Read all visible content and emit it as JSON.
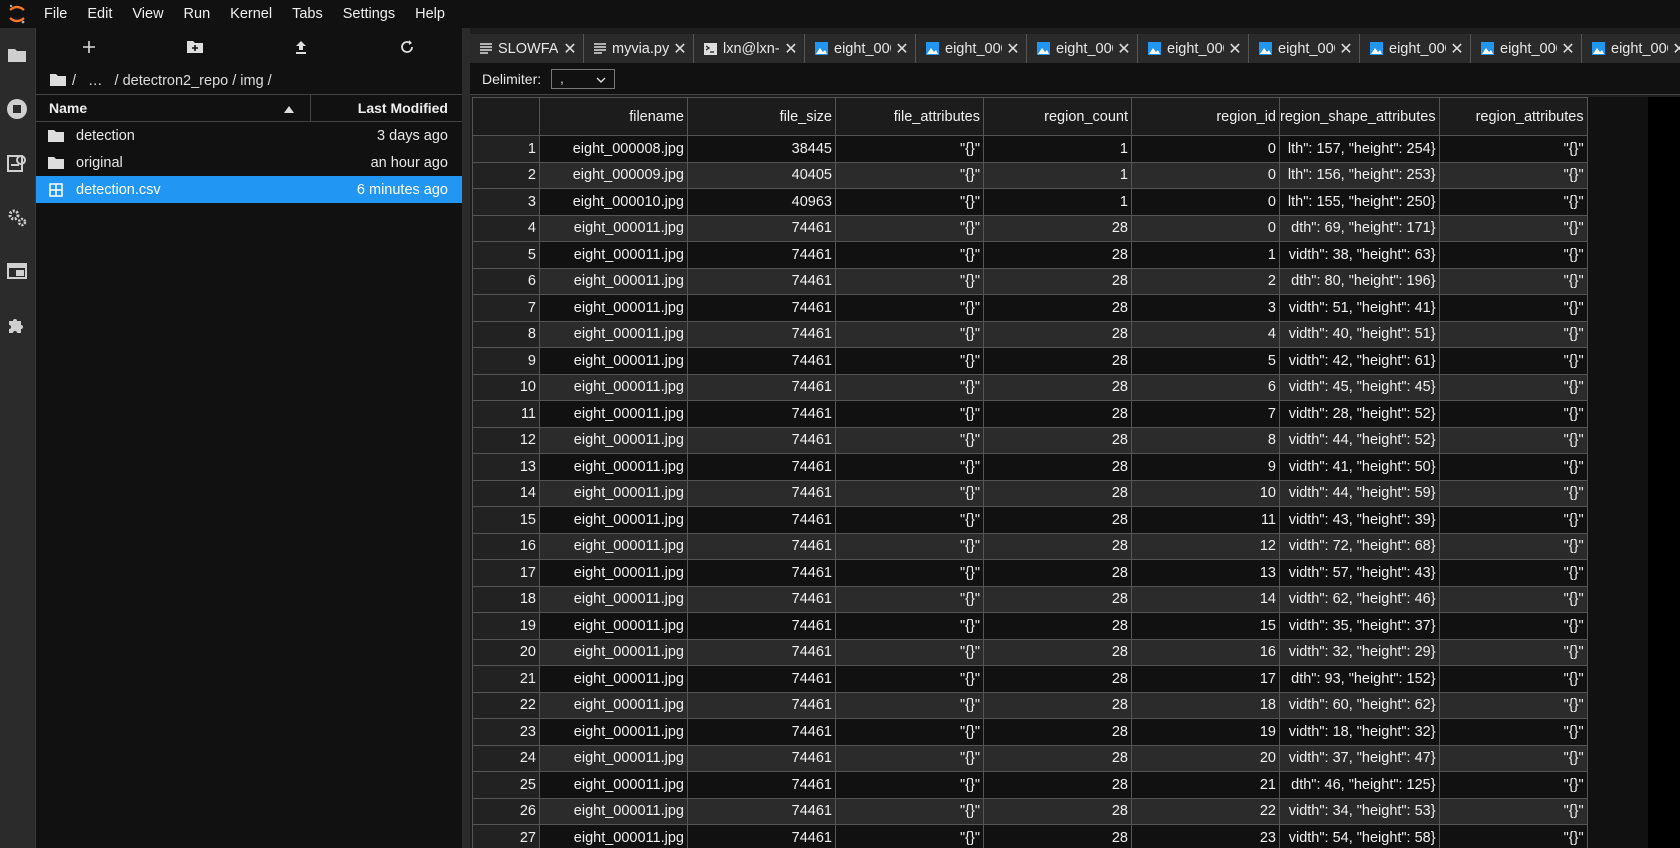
{
  "menubar": {
    "items": [
      "File",
      "Edit",
      "View",
      "Run",
      "Kernel",
      "Tabs",
      "Settings",
      "Help"
    ]
  },
  "activity": {
    "icons": [
      "folder-icon",
      "running-icon",
      "commands-icon",
      "property-inspector-icon",
      "tabs-icon",
      "extension-icon"
    ]
  },
  "filebrowser": {
    "toolbar": [
      "new-launcher-icon",
      "new-folder-icon",
      "upload-icon",
      "refresh-icon"
    ],
    "breadcrumb": {
      "root": "/",
      "ellipsis": "…",
      "path": "/ detectron2_repo / img /"
    },
    "header": {
      "name": "Name",
      "modified": "Last Modified"
    },
    "items": [
      {
        "name": "detection",
        "modified": "3 days ago",
        "type": "folder"
      },
      {
        "name": "original",
        "modified": "an hour ago",
        "type": "folder"
      },
      {
        "name": "detection.csv",
        "modified": "6 minutes ago",
        "type": "csv",
        "selected": true
      }
    ]
  },
  "tabs": [
    {
      "label": "SLOWFAST",
      "icon": "text-icon",
      "active": false
    },
    {
      "label": "myvia.py",
      "icon": "text-icon",
      "active": false
    },
    {
      "label": "lxn@lxn-",
      "icon": "terminal-icon",
      "active": false
    },
    {
      "label": "eight_000",
      "icon": "image-icon",
      "active": false
    },
    {
      "label": "eight_000",
      "icon": "image-icon",
      "active": false
    },
    {
      "label": "eight_000",
      "icon": "image-icon",
      "active": false
    },
    {
      "label": "eight_000",
      "icon": "image-icon",
      "active": false
    },
    {
      "label": "eight_000",
      "icon": "image-icon",
      "active": false
    },
    {
      "label": "eight_000",
      "icon": "image-icon",
      "active": false
    },
    {
      "label": "eight_000",
      "icon": "image-icon",
      "active": false
    },
    {
      "label": "eight_000",
      "icon": "image-icon",
      "active": false
    }
  ],
  "toolbar": {
    "delimiter_label": "Delimiter:",
    "delimiter_value": ","
  },
  "grid": {
    "columns": [
      "filename",
      "file_size",
      "file_attributes",
      "region_count",
      "region_id",
      "region_shape_attributes",
      "region_attributes"
    ],
    "rows": [
      [
        "1",
        "eight_000008.jpg",
        "38445",
        "\"{}\"",
        "1",
        "0",
        "lth\": 157, \"height\": 254}",
        "\"{}\""
      ],
      [
        "2",
        "eight_000009.jpg",
        "40405",
        "\"{}\"",
        "1",
        "0",
        "lth\": 156, \"height\": 253}",
        "\"{}\""
      ],
      [
        "3",
        "eight_000010.jpg",
        "40963",
        "\"{}\"",
        "1",
        "0",
        "lth\": 155, \"height\": 250}",
        "\"{}\""
      ],
      [
        "4",
        "eight_000011.jpg",
        "74461",
        "\"{}\"",
        "28",
        "0",
        "dth\": 69, \"height\": 171}",
        "\"{}\""
      ],
      [
        "5",
        "eight_000011.jpg",
        "74461",
        "\"{}\"",
        "28",
        "1",
        "vidth\": 38, \"height\": 63}",
        "\"{}\""
      ],
      [
        "6",
        "eight_000011.jpg",
        "74461",
        "\"{}\"",
        "28",
        "2",
        "dth\": 80, \"height\": 196}",
        "\"{}\""
      ],
      [
        "7",
        "eight_000011.jpg",
        "74461",
        "\"{}\"",
        "28",
        "3",
        "vidth\": 51, \"height\": 41}",
        "\"{}\""
      ],
      [
        "8",
        "eight_000011.jpg",
        "74461",
        "\"{}\"",
        "28",
        "4",
        "vidth\": 40, \"height\": 51}",
        "\"{}\""
      ],
      [
        "9",
        "eight_000011.jpg",
        "74461",
        "\"{}\"",
        "28",
        "5",
        "vidth\": 42, \"height\": 61}",
        "\"{}\""
      ],
      [
        "10",
        "eight_000011.jpg",
        "74461",
        "\"{}\"",
        "28",
        "6",
        "vidth\": 45, \"height\": 45}",
        "\"{}\""
      ],
      [
        "11",
        "eight_000011.jpg",
        "74461",
        "\"{}\"",
        "28",
        "7",
        "vidth\": 28, \"height\": 52}",
        "\"{}\""
      ],
      [
        "12",
        "eight_000011.jpg",
        "74461",
        "\"{}\"",
        "28",
        "8",
        "vidth\": 44, \"height\": 52}",
        "\"{}\""
      ],
      [
        "13",
        "eight_000011.jpg",
        "74461",
        "\"{}\"",
        "28",
        "9",
        "vidth\": 41, \"height\": 50}",
        "\"{}\""
      ],
      [
        "14",
        "eight_000011.jpg",
        "74461",
        "\"{}\"",
        "28",
        "10",
        "vidth\": 44, \"height\": 59}",
        "\"{}\""
      ],
      [
        "15",
        "eight_000011.jpg",
        "74461",
        "\"{}\"",
        "28",
        "11",
        "vidth\": 43, \"height\": 39}",
        "\"{}\""
      ],
      [
        "16",
        "eight_000011.jpg",
        "74461",
        "\"{}\"",
        "28",
        "12",
        "vidth\": 72, \"height\": 68}",
        "\"{}\""
      ],
      [
        "17",
        "eight_000011.jpg",
        "74461",
        "\"{}\"",
        "28",
        "13",
        "vidth\": 57, \"height\": 43}",
        "\"{}\""
      ],
      [
        "18",
        "eight_000011.jpg",
        "74461",
        "\"{}\"",
        "28",
        "14",
        "vidth\": 62, \"height\": 46}",
        "\"{}\""
      ],
      [
        "19",
        "eight_000011.jpg",
        "74461",
        "\"{}\"",
        "28",
        "15",
        "vidth\": 35, \"height\": 37}",
        "\"{}\""
      ],
      [
        "20",
        "eight_000011.jpg",
        "74461",
        "\"{}\"",
        "28",
        "16",
        "vidth\": 32, \"height\": 29}",
        "\"{}\""
      ],
      [
        "21",
        "eight_000011.jpg",
        "74461",
        "\"{}\"",
        "28",
        "17",
        "dth\": 93, \"height\": 152}",
        "\"{}\""
      ],
      [
        "22",
        "eight_000011.jpg",
        "74461",
        "\"{}\"",
        "28",
        "18",
        "vidth\": 60, \"height\": 62}",
        "\"{}\""
      ],
      [
        "23",
        "eight_000011.jpg",
        "74461",
        "\"{}\"",
        "28",
        "19",
        "vidth\": 18, \"height\": 32}",
        "\"{}\""
      ],
      [
        "24",
        "eight_000011.jpg",
        "74461",
        "\"{}\"",
        "28",
        "20",
        "vidth\": 37, \"height\": 47}",
        "\"{}\""
      ],
      [
        "25",
        "eight_000011.jpg",
        "74461",
        "\"{}\"",
        "28",
        "21",
        "dth\": 46, \"height\": 125}",
        "\"{}\""
      ],
      [
        "26",
        "eight_000011.jpg",
        "74461",
        "\"{}\"",
        "28",
        "22",
        "vidth\": 34, \"height\": 53}",
        "\"{}\""
      ],
      [
        "27",
        "eight_000011.jpg",
        "74461",
        "\"{}\"",
        "28",
        "23",
        "vidth\": 54, \"height\": 58}",
        "\"{}\""
      ]
    ]
  },
  "colors": {
    "accent": "#2196f3",
    "logo": "#f37726",
    "background": "#111111"
  }
}
